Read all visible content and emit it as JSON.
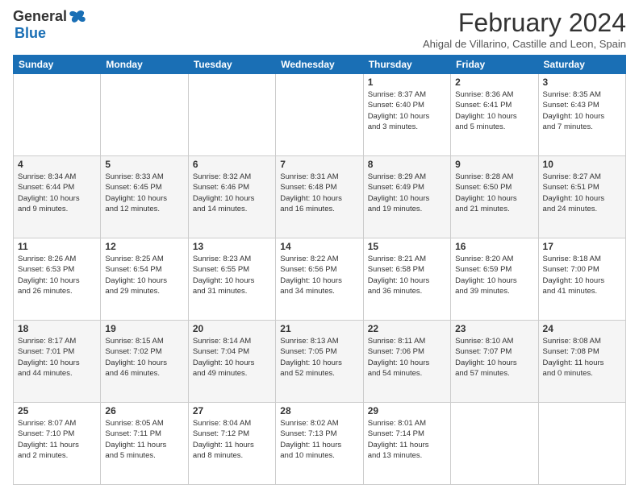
{
  "logo": {
    "general": "General",
    "blue": "Blue"
  },
  "header": {
    "month_year": "February 2024",
    "location": "Ahigal de Villarino, Castille and Leon, Spain"
  },
  "weekdays": [
    "Sunday",
    "Monday",
    "Tuesday",
    "Wednesday",
    "Thursday",
    "Friday",
    "Saturday"
  ],
  "weeks": [
    [
      {
        "day": "",
        "info": ""
      },
      {
        "day": "",
        "info": ""
      },
      {
        "day": "",
        "info": ""
      },
      {
        "day": "",
        "info": ""
      },
      {
        "day": "1",
        "info": "Sunrise: 8:37 AM\nSunset: 6:40 PM\nDaylight: 10 hours\nand 3 minutes."
      },
      {
        "day": "2",
        "info": "Sunrise: 8:36 AM\nSunset: 6:41 PM\nDaylight: 10 hours\nand 5 minutes."
      },
      {
        "day": "3",
        "info": "Sunrise: 8:35 AM\nSunset: 6:43 PM\nDaylight: 10 hours\nand 7 minutes."
      }
    ],
    [
      {
        "day": "4",
        "info": "Sunrise: 8:34 AM\nSunset: 6:44 PM\nDaylight: 10 hours\nand 9 minutes."
      },
      {
        "day": "5",
        "info": "Sunrise: 8:33 AM\nSunset: 6:45 PM\nDaylight: 10 hours\nand 12 minutes."
      },
      {
        "day": "6",
        "info": "Sunrise: 8:32 AM\nSunset: 6:46 PM\nDaylight: 10 hours\nand 14 minutes."
      },
      {
        "day": "7",
        "info": "Sunrise: 8:31 AM\nSunset: 6:48 PM\nDaylight: 10 hours\nand 16 minutes."
      },
      {
        "day": "8",
        "info": "Sunrise: 8:29 AM\nSunset: 6:49 PM\nDaylight: 10 hours\nand 19 minutes."
      },
      {
        "day": "9",
        "info": "Sunrise: 8:28 AM\nSunset: 6:50 PM\nDaylight: 10 hours\nand 21 minutes."
      },
      {
        "day": "10",
        "info": "Sunrise: 8:27 AM\nSunset: 6:51 PM\nDaylight: 10 hours\nand 24 minutes."
      }
    ],
    [
      {
        "day": "11",
        "info": "Sunrise: 8:26 AM\nSunset: 6:53 PM\nDaylight: 10 hours\nand 26 minutes."
      },
      {
        "day": "12",
        "info": "Sunrise: 8:25 AM\nSunset: 6:54 PM\nDaylight: 10 hours\nand 29 minutes."
      },
      {
        "day": "13",
        "info": "Sunrise: 8:23 AM\nSunset: 6:55 PM\nDaylight: 10 hours\nand 31 minutes."
      },
      {
        "day": "14",
        "info": "Sunrise: 8:22 AM\nSunset: 6:56 PM\nDaylight: 10 hours\nand 34 minutes."
      },
      {
        "day": "15",
        "info": "Sunrise: 8:21 AM\nSunset: 6:58 PM\nDaylight: 10 hours\nand 36 minutes."
      },
      {
        "day": "16",
        "info": "Sunrise: 8:20 AM\nSunset: 6:59 PM\nDaylight: 10 hours\nand 39 minutes."
      },
      {
        "day": "17",
        "info": "Sunrise: 8:18 AM\nSunset: 7:00 PM\nDaylight: 10 hours\nand 41 minutes."
      }
    ],
    [
      {
        "day": "18",
        "info": "Sunrise: 8:17 AM\nSunset: 7:01 PM\nDaylight: 10 hours\nand 44 minutes."
      },
      {
        "day": "19",
        "info": "Sunrise: 8:15 AM\nSunset: 7:02 PM\nDaylight: 10 hours\nand 46 minutes."
      },
      {
        "day": "20",
        "info": "Sunrise: 8:14 AM\nSunset: 7:04 PM\nDaylight: 10 hours\nand 49 minutes."
      },
      {
        "day": "21",
        "info": "Sunrise: 8:13 AM\nSunset: 7:05 PM\nDaylight: 10 hours\nand 52 minutes."
      },
      {
        "day": "22",
        "info": "Sunrise: 8:11 AM\nSunset: 7:06 PM\nDaylight: 10 hours\nand 54 minutes."
      },
      {
        "day": "23",
        "info": "Sunrise: 8:10 AM\nSunset: 7:07 PM\nDaylight: 10 hours\nand 57 minutes."
      },
      {
        "day": "24",
        "info": "Sunrise: 8:08 AM\nSunset: 7:08 PM\nDaylight: 11 hours\nand 0 minutes."
      }
    ],
    [
      {
        "day": "25",
        "info": "Sunrise: 8:07 AM\nSunset: 7:10 PM\nDaylight: 11 hours\nand 2 minutes."
      },
      {
        "day": "26",
        "info": "Sunrise: 8:05 AM\nSunset: 7:11 PM\nDaylight: 11 hours\nand 5 minutes."
      },
      {
        "day": "27",
        "info": "Sunrise: 8:04 AM\nSunset: 7:12 PM\nDaylight: 11 hours\nand 8 minutes."
      },
      {
        "day": "28",
        "info": "Sunrise: 8:02 AM\nSunset: 7:13 PM\nDaylight: 11 hours\nand 10 minutes."
      },
      {
        "day": "29",
        "info": "Sunrise: 8:01 AM\nSunset: 7:14 PM\nDaylight: 11 hours\nand 13 minutes."
      },
      {
        "day": "",
        "info": ""
      },
      {
        "day": "",
        "info": ""
      }
    ]
  ]
}
